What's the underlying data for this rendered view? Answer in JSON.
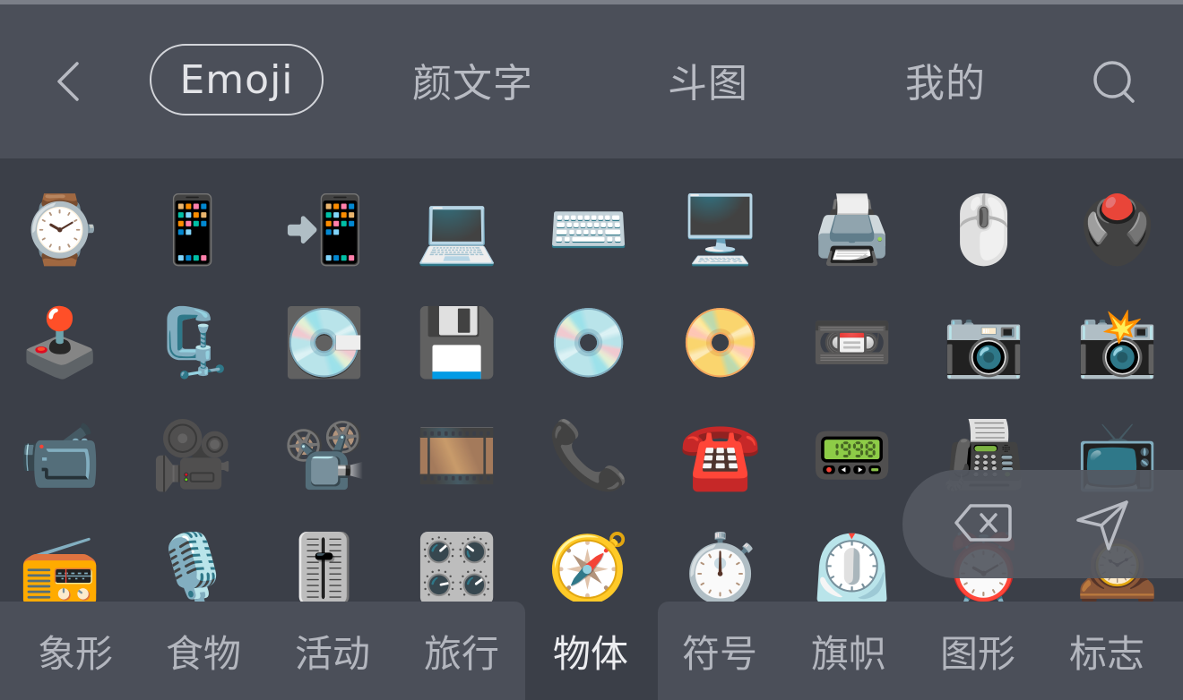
{
  "colors": {
    "header_bg": "#4b4f59",
    "panel_bg": "#3b3f48",
    "tab_text": "#b8bbc3",
    "active_outline": "#d3d5da"
  },
  "header": {
    "back_icon": "chevron-left-icon",
    "search_icon": "search-icon",
    "tabs": [
      {
        "label": "Emoji",
        "active": true
      },
      {
        "label": "颜文字",
        "active": false
      },
      {
        "label": "斗图",
        "active": false
      },
      {
        "label": "我的",
        "active": false
      }
    ]
  },
  "emoji_grid": {
    "rows": [
      [
        "⌚",
        "📱",
        "📲",
        "💻",
        "⌨️",
        "🖥️",
        "🖨️",
        "🖱️",
        "🖲️"
      ],
      [
        "🕹️",
        "🗜️",
        "💽",
        "💾",
        "💿",
        "📀",
        "📼",
        "📷",
        "📸"
      ],
      [
        "📹",
        "🎥",
        "📽️",
        "🎞️",
        "📞",
        "☎️",
        "📟",
        "📠",
        "📺"
      ],
      [
        "📻",
        "🎙️",
        "🎚️",
        "🎛️",
        "🧭",
        "⏱️",
        "⏲️",
        "⏰",
        "🕰️"
      ]
    ]
  },
  "floating_actions": {
    "delete_icon": "backspace-icon",
    "send_icon": "send-icon"
  },
  "categories": {
    "left": [
      "象形",
      "食物",
      "活动",
      "旅行"
    ],
    "active": "物体",
    "right": [
      "符号",
      "旗帜",
      "图形",
      "标志"
    ]
  }
}
